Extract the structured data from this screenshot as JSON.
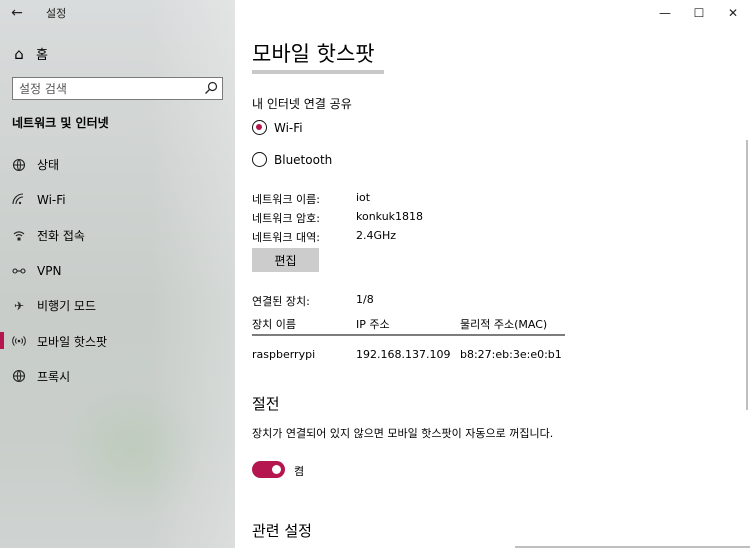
{
  "window": {
    "app_title": "설정"
  },
  "sidebar": {
    "home_label": "홈",
    "search_placeholder": "설정 검색",
    "section_title": "네트워크 및 인터넷",
    "items": [
      {
        "label": "상태",
        "icon": "globe-status-icon"
      },
      {
        "label": "Wi-Fi",
        "icon": "wifi-icon"
      },
      {
        "label": "전화 접속",
        "icon": "dialup-icon"
      },
      {
        "label": "VPN",
        "icon": "vpn-icon"
      },
      {
        "label": "비행기 모드",
        "icon": "airplane-icon"
      },
      {
        "label": "모바일 핫스팟",
        "icon": "hotspot-icon",
        "active": true
      },
      {
        "label": "프록시",
        "icon": "proxy-globe-icon"
      }
    ]
  },
  "main": {
    "title": "모바일 핫스팟",
    "share_label": "내 인터넷 연결 공유",
    "options": [
      {
        "label": "Wi-Fi",
        "selected": true
      },
      {
        "label": "Bluetooth",
        "selected": false
      }
    ],
    "network": {
      "name_key": "네트워크 이름:",
      "name_val": "iot",
      "password_key": "네트워크 암호:",
      "password_val": "konkuk1818",
      "band_key": "네트워크 대역:",
      "band_val": "2.4GHz"
    },
    "edit_label": "편집",
    "connected_key": "연결된 장치:",
    "connected_val": "1/8",
    "table": {
      "headers": [
        "장치 이름",
        "IP 주소",
        "물리적 주소(MAC)"
      ],
      "rows": [
        [
          "raspberrypi",
          "192.168.137.109",
          "b8:27:eb:3e:e0:b1"
        ]
      ]
    },
    "power_title": "절전",
    "power_desc": "장치가 연결되어 있지 않으면 모바일 핫스팟이 자동으로 꺼집니다.",
    "power_toggle_label": "켬",
    "power_toggle_on": true,
    "related_title": "관련 설정"
  },
  "colors": {
    "accent": "#b5164f"
  }
}
